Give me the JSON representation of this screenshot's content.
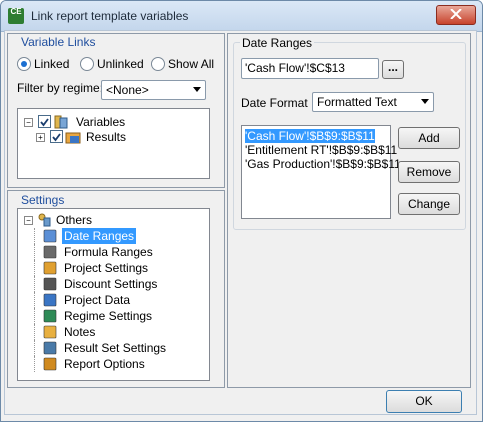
{
  "window": {
    "title": "Link report template variables",
    "app_icon_text": "CE"
  },
  "variable_links": {
    "title": "Variable Links",
    "radios": [
      {
        "label": "Linked",
        "selected": true
      },
      {
        "label": "Unlinked",
        "selected": false
      },
      {
        "label": "Show All",
        "selected": false
      }
    ],
    "filter_label": "Filter by regime:",
    "filter_value": "<None>",
    "tree": [
      {
        "label": "Variables",
        "checked": true,
        "icon": "variables-icon"
      },
      {
        "label": "Results",
        "checked": true,
        "icon": "results-icon"
      }
    ]
  },
  "settings": {
    "title": "Settings",
    "root": "Others",
    "items": [
      {
        "label": "Date Ranges",
        "icon": "calendar-icon",
        "selected": true
      },
      {
        "label": "Formula Ranges",
        "icon": "function-icon"
      },
      {
        "label": "Project Settings",
        "icon": "project-settings-icon"
      },
      {
        "label": "Discount Settings",
        "icon": "percent-icon"
      },
      {
        "label": "Project Data",
        "icon": "project-data-icon"
      },
      {
        "label": "Regime Settings",
        "icon": "regime-icon"
      },
      {
        "label": "Notes",
        "icon": "notes-icon"
      },
      {
        "label": "Result Set Settings",
        "icon": "result-set-icon"
      },
      {
        "label": "Report Options",
        "icon": "report-options-icon"
      }
    ]
  },
  "date_ranges": {
    "title": "Date Ranges",
    "cell_ref": "'Cash Flow'!$C$13",
    "browse_label": "...",
    "format_label": "Date Format",
    "format_value": "Formatted Text",
    "list": [
      {
        "text": "'Cash Flow'!$B$9:$B$11",
        "selected": true
      },
      {
        "text": "'Entitlement RT'!$B$9:$B$11"
      },
      {
        "text": "'Gas Production'!$B$9:$B$11"
      }
    ],
    "buttons": {
      "add": "Add",
      "remove": "Remove",
      "change": "Change"
    }
  },
  "ok_label": "OK",
  "colors": {
    "selection": "#3399ff",
    "group_title": "#1f4e9e"
  }
}
